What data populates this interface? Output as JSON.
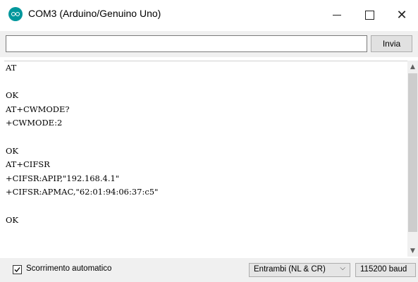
{
  "window": {
    "title": "COM3 (Arduino/Genuino Uno)",
    "icon": "arduino-logo-icon",
    "controls": {
      "minimize": "minimize-icon",
      "maximize": "maximize-icon",
      "close": "close-icon",
      "close_glyph": "✕"
    }
  },
  "send": {
    "input_value": "",
    "button_label": "Invia"
  },
  "output": {
    "lines": [
      "AT",
      "",
      "OK",
      "AT+CWMODE?",
      "+CWMODE:2",
      "",
      "OK",
      "AT+CIFSR",
      "+CIFSR:APIP,\"192.168.4.1\"",
      "+CIFSR:APMAC,\"62:01:94:06:37:c5\"",
      "",
      "OK"
    ]
  },
  "footer": {
    "autoscroll_label": "Scorrimento automatico",
    "autoscroll_checked": true,
    "line_ending": "Entrambi (NL & CR)",
    "baud": "115200 baud"
  },
  "colors": {
    "accent": "#00979c",
    "panel": "#f0f0f0"
  }
}
